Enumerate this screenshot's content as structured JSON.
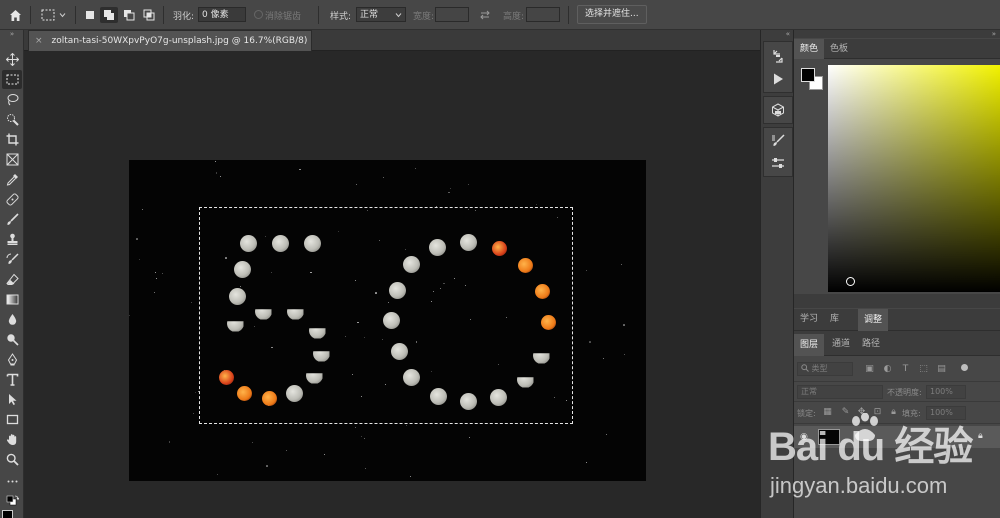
{
  "options_bar": {
    "feather_label": "羽化:",
    "feather_value": "0 像素",
    "antialias_label": "消除锯齿",
    "style_label": "样式:",
    "style_value": "正常",
    "width_label": "宽度:",
    "height_label": "高度:",
    "select_mask_button": "选择并遮住..."
  },
  "document": {
    "tab_close": "×",
    "tab_title": "zoltan-tasi-50WXpvPyO7g-unsplash.jpg @ 16.7%(RGB/8)"
  },
  "color_panel": {
    "tabs": [
      "颜色",
      "色板"
    ],
    "active_tab": 0,
    "picker_hue": "#f2f200"
  },
  "learn_panel": {
    "tabs": [
      "学习",
      "库",
      "调整"
    ],
    "active_tab": 2
  },
  "layers_panel": {
    "tabs": [
      "图层",
      "通道",
      "路径"
    ],
    "active_tab": 0,
    "filter_label": "类型",
    "blend_mode": "正常",
    "opacity_label": "不透明度:",
    "opacity_value": "100%",
    "lock_label": "锁定:",
    "fill_label": "填充:",
    "fill_value": "100%"
  },
  "watermark": {
    "logo_text": "Bai du 经验",
    "url": "jingyan.baidu.com"
  },
  "colors": {
    "panel_bg": "#474747",
    "canvas_bg": "#282828",
    "moon_gray": "#bdbdb6",
    "moon_red": "#d8401a",
    "moon_orange": "#ee7a18"
  }
}
